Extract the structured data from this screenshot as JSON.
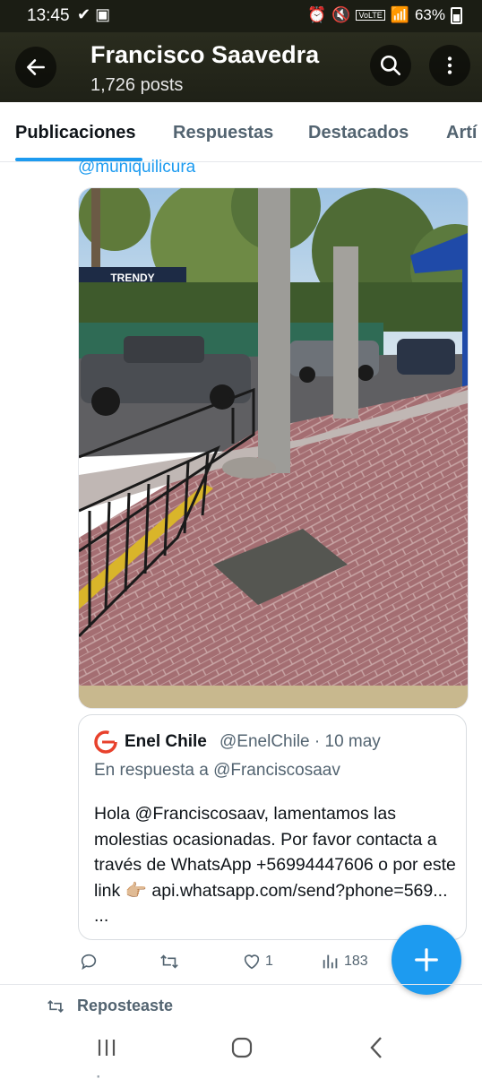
{
  "status_bar": {
    "time": "13:45",
    "battery": "63%",
    "network": "VoLTE"
  },
  "header": {
    "title": "Francisco Saavedra",
    "subtitle": "1,726 posts"
  },
  "tabs": [
    {
      "label": "Publicaciones",
      "active": true
    },
    {
      "label": "Respuestas"
    },
    {
      "label": "Destacados"
    },
    {
      "label": "Artí"
    }
  ],
  "post": {
    "mention": "@muniquilicura",
    "photo_alt": "",
    "sign_text": "TRENDY"
  },
  "quote": {
    "name": "Enel Chile",
    "handle_date": "@EnelChile · 10 may",
    "reply_to": "En respuesta a @Franciscosaav",
    "text": "Hola @Franciscosaav, lamentamos las molestias ocasionadas. Por favor contacta a través de  WhatsApp +56994447606 o por este link 👉🏼 api.whatsapp.com/send?phone=569... ...",
    "logo_color": "#e8412c"
  },
  "actions": {
    "likes": "1",
    "views": "183"
  },
  "footer": {
    "reposted": "Reposteaste",
    "reposted_ghost": "Reposteaste"
  },
  "colors": {
    "accent": "#1d9bf0",
    "header_bg": "#1f2117"
  }
}
